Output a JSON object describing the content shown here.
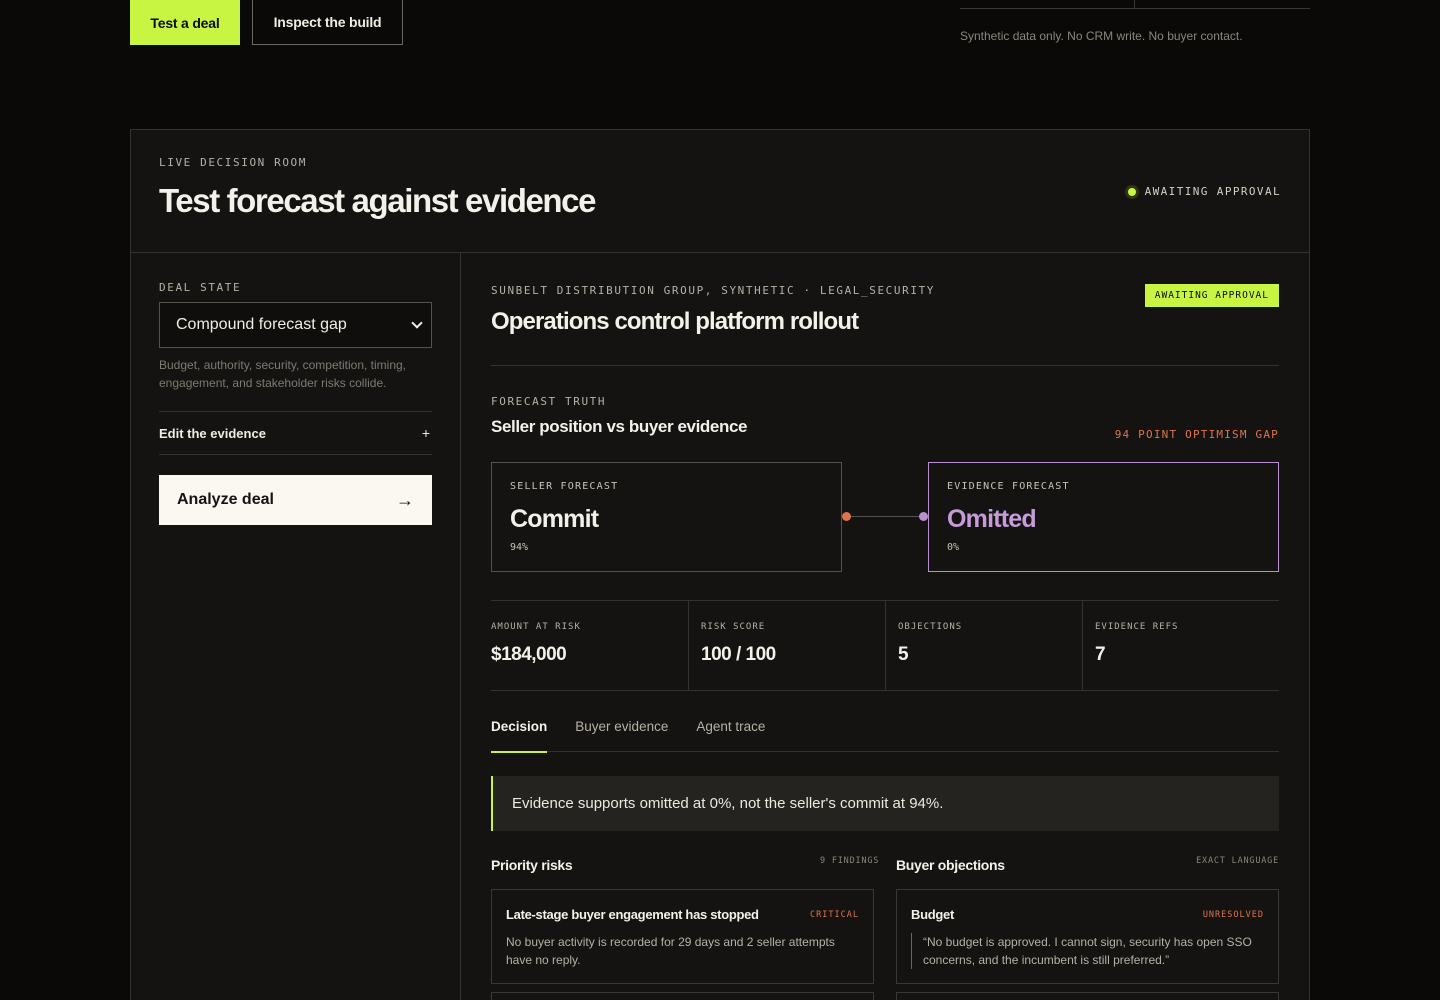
{
  "top": {
    "primary_button": "Test a deal",
    "secondary_button": "Inspect the build",
    "disclaimer": "Synthetic data only. No CRM write. No buyer contact."
  },
  "panel": {
    "eyebrow": "LIVE DECISION ROOM",
    "title": "Test forecast against evidence",
    "status": "AWAITING APPROVAL"
  },
  "sidebar": {
    "eyebrow": "DEAL STATE",
    "select_value": "Compound forecast gap",
    "select_help": "Budget, authority, security, competition, timing, engagement, and stakeholder risks collide.",
    "edit_label": "Edit the evidence",
    "edit_icon": "+",
    "analyze_label": "Analyze deal",
    "analyze_icon": "→"
  },
  "deal": {
    "eyebrow": "SUNBELT DISTRIBUTION GROUP, SYNTHETIC · LEGAL_SECURITY",
    "title": "Operations control platform rollout",
    "badge": "AWAITING APPROVAL"
  },
  "forecast": {
    "eyebrow": "FORECAST TRUTH",
    "title": "Seller position vs buyer evidence",
    "gap_label": "94 POINT OPTIMISM GAP",
    "seller": {
      "eyebrow": "SELLER FORECAST",
      "value": "Commit",
      "pct": "94%"
    },
    "evidence": {
      "eyebrow": "EVIDENCE FORECAST",
      "value": "Omitted",
      "pct": "0%"
    }
  },
  "stats": [
    {
      "label": "AMOUNT AT RISK",
      "value": "$184,000"
    },
    {
      "label": "RISK SCORE",
      "value": "100 / 100"
    },
    {
      "label": "OBJECTIONS",
      "value": "5"
    },
    {
      "label": "EVIDENCE REFS",
      "value": "7"
    }
  ],
  "tabs": [
    "Decision",
    "Buyer evidence",
    "Agent trace"
  ],
  "callout": "Evidence supports omitted at 0%, not the seller's commit at 94%.",
  "risks": {
    "heading": "Priority risks",
    "meta": "9 FINDINGS",
    "items": [
      {
        "title": "Late-stage buyer engagement has stopped",
        "tag": "CRITICAL",
        "body": "No buyer activity is recorded for 29 days and 2 seller attempts have no reply."
      }
    ]
  },
  "objections": {
    "heading": "Buyer objections",
    "meta": "EXACT LANGUAGE",
    "items": [
      {
        "title": "Budget",
        "tag": "UNRESOLVED",
        "quote": "“No budget is approved. I cannot sign, security has open SSO concerns, and the incumbent is still preferred.”"
      }
    ]
  },
  "colors": {
    "accent": "#c8f542",
    "warning": "#e0734b",
    "evidence": "#b98fcf",
    "background": "#0a0908",
    "panel": "#141311"
  }
}
